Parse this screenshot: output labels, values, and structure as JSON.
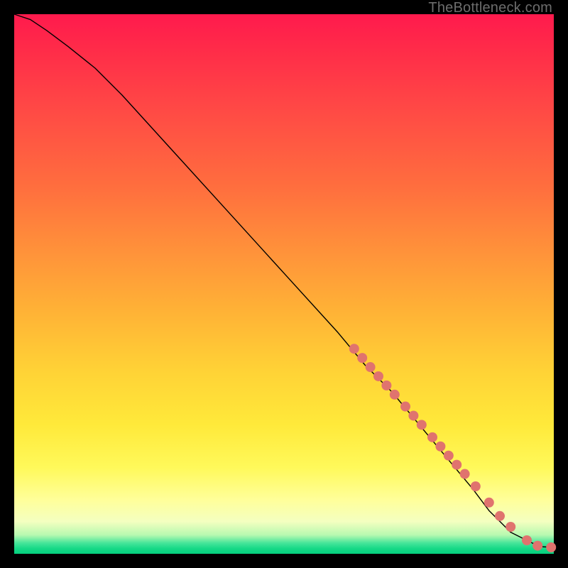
{
  "watermark": "TheBottleneck.com",
  "chart_data": {
    "type": "line",
    "title": "",
    "xlabel": "",
    "ylabel": "",
    "xlim": [
      0,
      100
    ],
    "ylim": [
      0,
      100
    ],
    "grid": false,
    "legend": false,
    "background_gradient": [
      "#ff1a4d",
      "#ff6e3e",
      "#ffd236",
      "#ffff9a",
      "#17d987"
    ],
    "series": [
      {
        "name": "curve",
        "type": "line",
        "color": "#000000",
        "width": 1.4,
        "x": [
          0,
          3,
          6,
          10,
          15,
          20,
          30,
          40,
          50,
          60,
          65,
          70,
          75,
          80,
          85,
          88,
          90,
          92,
          94,
          96,
          98,
          100
        ],
        "y": [
          100,
          99,
          97,
          94,
          90,
          85,
          74,
          63,
          52,
          41,
          35,
          30,
          24,
          18,
          12,
          8,
          6,
          4,
          3,
          2,
          1.3,
          1.2
        ]
      },
      {
        "name": "highlight-dots",
        "type": "scatter",
        "color": "#e0736e",
        "radius": 7,
        "x": [
          63,
          64.5,
          66,
          67.5,
          69,
          70.5,
          72.5,
          74,
          75.5,
          77.5,
          79,
          80.5,
          82,
          83.5,
          85.5,
          88,
          90,
          92,
          95,
          97,
          99.5
        ],
        "y": [
          38,
          36.3,
          34.6,
          32.9,
          31.2,
          29.5,
          27.3,
          25.6,
          23.9,
          21.6,
          19.9,
          18.2,
          16.5,
          14.8,
          12.5,
          9.5,
          7,
          5,
          2.5,
          1.5,
          1.2
        ]
      }
    ]
  }
}
